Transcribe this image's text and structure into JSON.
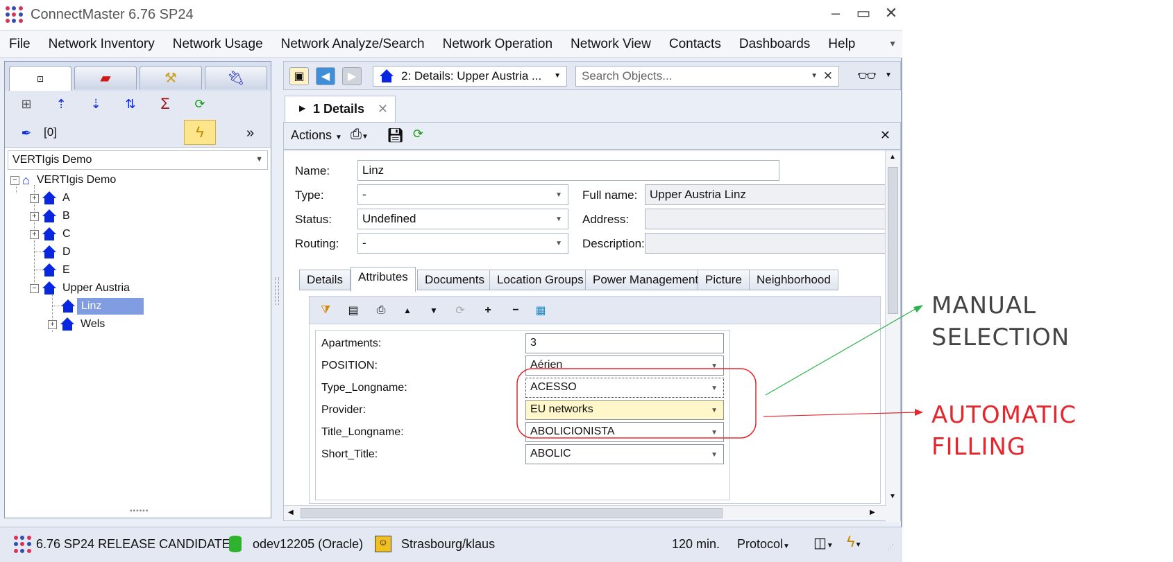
{
  "window": {
    "title": "ConnectMaster 6.76 SP24",
    "minimize": "–",
    "maximize": "▭",
    "close": "✕"
  },
  "menu": [
    "File",
    "Network Inventory",
    "Network Usage",
    "Network Analyze/Search",
    "Network Operation",
    "Network View",
    "Contacts",
    "Dashboards",
    "Help"
  ],
  "left": {
    "filter_count": "[0]",
    "more": "»",
    "project_select": "VERTIgis Demo",
    "tree": {
      "root": "VERTIgis Demo",
      "nodes": [
        "A",
        "B",
        "C",
        "D",
        "E",
        "Upper Austria",
        "Linz",
        "Wels"
      ]
    }
  },
  "right": {
    "nav_dropdown": "2: Details: Upper Austria ...",
    "search_placeholder": "Search Objects...",
    "search_clear": "✕",
    "doc_tab": "1 Details",
    "doc_tab_close": "✕",
    "actions_label": "Actions",
    "panel_close": "✕"
  },
  "form": {
    "name_label": "Name:",
    "name_value": "Linz",
    "type_label": "Type:",
    "type_value": "-",
    "fullname_label": "Full name:",
    "fullname_value": "Upper Austria Linz",
    "status_label": "Status:",
    "status_value": "Undefined",
    "address_label": "Address:",
    "address_value": "",
    "routing_label": "Routing:",
    "routing_value": "-",
    "description_label": "Description:",
    "description_value": "",
    "tabs": [
      "Details",
      "Attributes",
      "Documents",
      "Location Groups",
      "Power Management",
      "Picture",
      "Neighborhood"
    ],
    "active_tab": "Attributes"
  },
  "attributes": [
    {
      "label": "Apartments:",
      "value": "3",
      "dropdown": false
    },
    {
      "label": "POSITION:",
      "value": "Aérien",
      "dropdown": true
    },
    {
      "label": "Type_Longname:",
      "value": "ACESSO",
      "dropdown": true
    },
    {
      "label": "Provider:",
      "value": "EU networks",
      "dropdown": true
    },
    {
      "label": "Title_Longname:",
      "value": "ABOLICIONISTA",
      "dropdown": true
    },
    {
      "label": "Short_Title:",
      "value": "ABOLIC",
      "dropdown": true
    }
  ],
  "status": {
    "release": "6.76 SP24 RELEASE CANDIDATE",
    "db": "odev12205 (Oracle)",
    "user": "Strasbourg/klaus",
    "timeout": "120 min.",
    "protocol": "Protocol"
  },
  "annotations": {
    "manual_line1": "MANUAL",
    "manual_line2": "SELECTION",
    "automatic": "AUTOMATIC FILLING",
    "manual_color": "#444444",
    "automatic_color": "#e5272d",
    "green_line": "#2bb34a",
    "red_line": "#e5272d"
  }
}
